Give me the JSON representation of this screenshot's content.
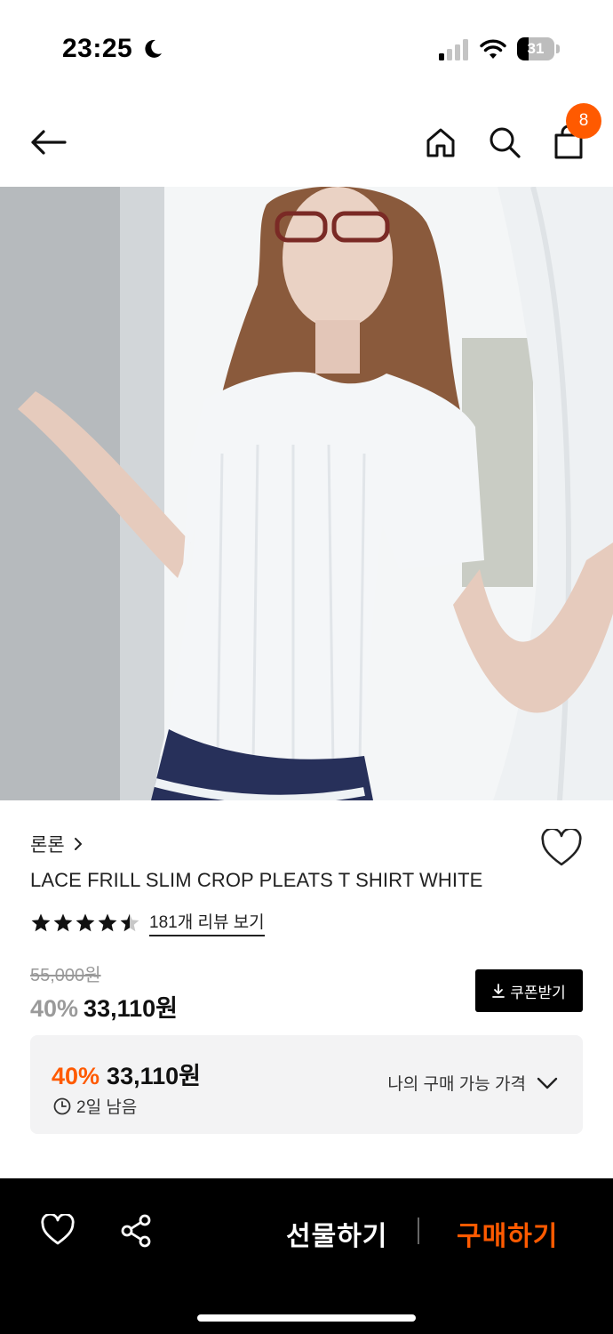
{
  "status_bar": {
    "time": "23:25",
    "battery_level": "31",
    "battery_fraction": 0.31
  },
  "nav": {
    "cart_count": "8",
    "icons": [
      "arrow-left-icon",
      "home-icon",
      "search-icon",
      "shopping-bag-icon"
    ]
  },
  "product": {
    "brand": "론론",
    "name": "LACE FRILL SLIM CROP PLEATS T SHIRT WHITE",
    "rating": 4.5,
    "review_link": "181개 리뷰 보기",
    "original_price": "55,000원",
    "discount_rate": "40%",
    "sale_price": "33,110원",
    "coupon_button": "쿠폰받기",
    "image_page": 1
  },
  "price_box": {
    "discount_rate": "40%",
    "price": "33,110원",
    "time_left": "2일 남음",
    "my_price_link": "나의 구매 가능 가격"
  },
  "bottom_bar": {
    "gift_label": "선물하기",
    "buy_label": "구매하기"
  },
  "colors": {
    "accent": "#ff5a00",
    "dark": "#000000",
    "muted": "#999999",
    "panel": "#f3f3f4"
  }
}
